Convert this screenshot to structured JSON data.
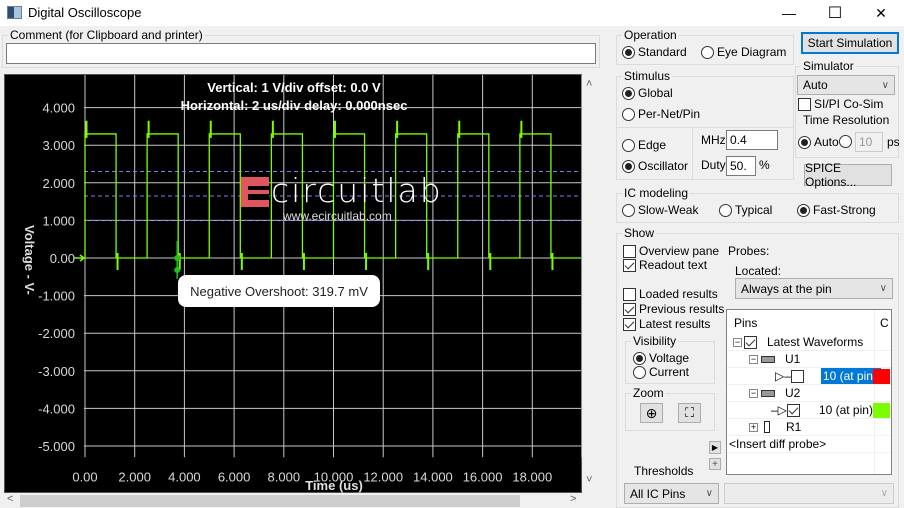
{
  "window": {
    "title": "Digital Oscilloscope",
    "minimize_glyph": "—",
    "maximize_glyph": "☐",
    "close_glyph": "✕"
  },
  "comment": {
    "label": "Comment (for Clipboard and printer)",
    "value": ""
  },
  "scope": {
    "header_line1": "Vertical: 1  V/div  offset: 0.0 V",
    "header_line2": "Horizontal: 2 us/div  delay: 0.000nsec",
    "logo_text": "circuitlab",
    "logo_url": "www.ecircuitlab.com",
    "tooltip": "Negative Overshoot: 319.7 mV",
    "trace_color": "#7cfc00",
    "threshold_color": "#7b7bff"
  },
  "chart_data": {
    "type": "line",
    "title": "",
    "xlabel": "Time  (us)",
    "ylabel": "Voltage  - V-",
    "xlim": [
      0,
      20
    ],
    "ylim": [
      -5.3,
      4.5
    ],
    "x_ticks": [
      "0.00",
      "2.000",
      "4.000",
      "6.000",
      "8.000",
      "10.000",
      "12.000",
      "14.000",
      "16.000",
      "18.000"
    ],
    "x_tick_values": [
      0,
      2,
      4,
      6,
      8,
      10,
      12,
      14,
      16,
      18
    ],
    "y_ticks": [
      "4.000",
      "3.000",
      "2.000",
      "1.000",
      "0.00",
      "-1.000",
      "-2.000",
      "-3.000",
      "-4.000",
      "-5.000"
    ],
    "y_tick_values": [
      4,
      3,
      2,
      1,
      0,
      -1,
      -2,
      -3,
      -4,
      -5
    ],
    "grid": true,
    "threshold_lines": [
      2.3,
      1.65,
      1.0
    ],
    "series": [
      {
        "name": "U2 10 (at pin)",
        "color": "#7cfc00",
        "waveform": "square",
        "frequency_mhz": 0.4,
        "duty": 0.5,
        "high_v": 3.3,
        "low_v": 0.0,
        "overshoot_v": 3.65,
        "undershoot_v": -0.32,
        "first_rise_us": 0.0
      }
    ],
    "annotation": {
      "text": "Negative Overshoot: 319.7 mV",
      "x_us": 3.75,
      "y_v": -0.32
    }
  },
  "operation": {
    "label": "Operation",
    "options": [
      {
        "label": "Standard",
        "selected": true
      },
      {
        "label": "Eye Diagram",
        "selected": false
      }
    ]
  },
  "start_button": "Start Simulation",
  "simulator": {
    "label": "Simulator",
    "selected": "Auto",
    "sipi_label": "SI/PI Co-Sim",
    "sipi_checked": false
  },
  "time_resolution": {
    "label": "Time Resolution",
    "auto_label": "Auto",
    "auto_selected": true,
    "value": "10",
    "unit": "ps"
  },
  "spice_button": "SPICE Options...",
  "stimulus": {
    "label": "Stimulus",
    "scope_options": [
      {
        "label": "Global",
        "selected": true
      },
      {
        "label": "Per-Net/Pin",
        "selected": false
      }
    ],
    "type_options": [
      {
        "label": "Edge",
        "selected": false
      },
      {
        "label": "Oscillator",
        "selected": true
      }
    ],
    "mhz_label": "MHz",
    "mhz_value": "0.4",
    "duty_label": "Duty",
    "duty_value": "50.",
    "duty_unit": "%"
  },
  "ic_modeling": {
    "label": "IC modeling",
    "options": [
      {
        "label": "Slow-Weak",
        "selected": false
      },
      {
        "label": "Typical",
        "selected": false
      },
      {
        "label": "Fast-Strong",
        "selected": true
      }
    ]
  },
  "show": {
    "label": "Show",
    "checks": [
      {
        "label": "Overview pane",
        "checked": false
      },
      {
        "label": "Readout text",
        "checked": true
      },
      {
        "label": "Loaded results",
        "checked": false
      },
      {
        "label": "Previous results",
        "checked": true
      },
      {
        "label": "Latest results",
        "checked": true
      }
    ],
    "visibility_label": "Visibility",
    "visibility_options": [
      {
        "label": "Voltage",
        "selected": true
      },
      {
        "label": "Current",
        "selected": false
      }
    ],
    "zoom_label": "Zoom",
    "thresholds_label": "Thresholds",
    "thresholds_selected": "All IC Pins",
    "thresholds_second_value": ""
  },
  "probes": {
    "label": "Probes:",
    "located_label": "Located:",
    "located_selected": "Always at the pin",
    "columns": [
      "Pins",
      "C"
    ],
    "tree": [
      {
        "label": "Latest Waveforms",
        "level": 0,
        "expander": "−",
        "checked": true
      },
      {
        "label": "U1",
        "level": 1,
        "expander": "−"
      },
      {
        "label": "10 (at pin)",
        "level": 2,
        "checked": false,
        "selected": true,
        "color": "#ff0000"
      },
      {
        "label": "U2",
        "level": 1,
        "expander": "−"
      },
      {
        "label": "10 (at pin)",
        "level": 2,
        "checked": true,
        "selected": false,
        "color": "#7cfc00"
      },
      {
        "label": "R1",
        "level": 1,
        "expander": "+"
      }
    ],
    "insert_label": "<Insert diff probe>"
  }
}
